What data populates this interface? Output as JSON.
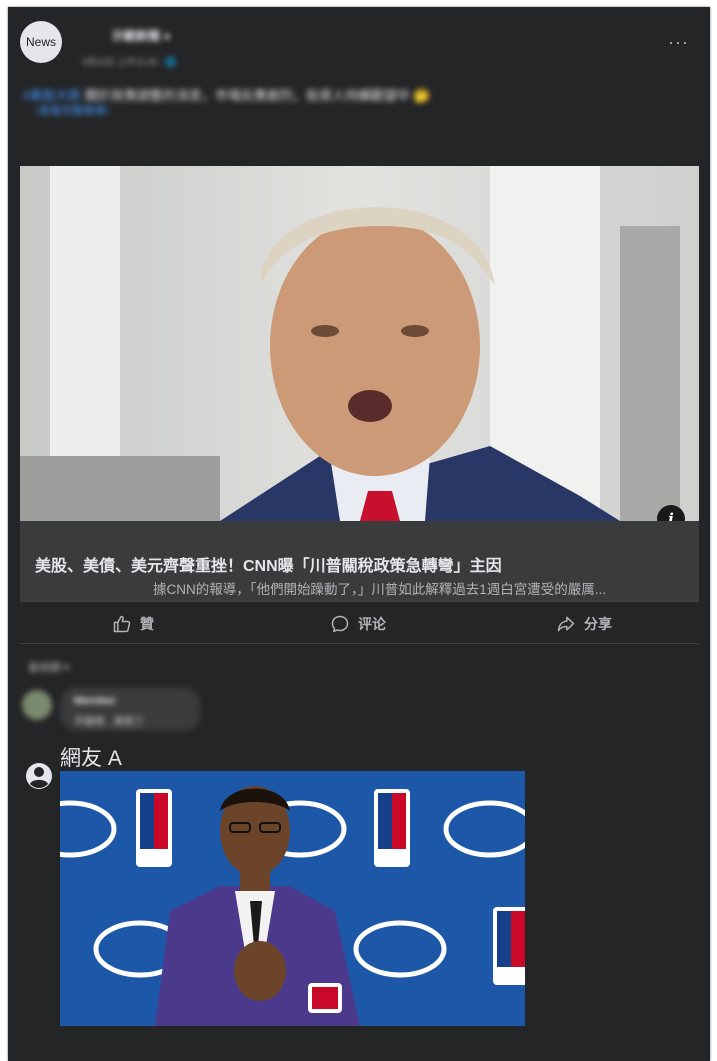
{
  "post": {
    "avatar_text": "News",
    "page_name": "示範新聞 ●",
    "meta": "3月10日 上午11:45 · 🌐",
    "text_highlight": "#美股大跌",
    "text_rest": " 關於政策調整的消息，市場反應劇烈，投資人持續觀望中 🤔",
    "link": "（查看完整報導）",
    "more": "···"
  },
  "article": {
    "title": "美股、美債、美元齊聲重挫！CNN曝「川普關稅政策急轉彎」主因",
    "description": "據CNN的報導，「他們開始躁動了，」川普如此解釋過去1週白宮遭受的嚴厲...",
    "info_icon": "i"
  },
  "actions": {
    "like": "贊",
    "comment": "评论",
    "share": "分享"
  },
  "comments": {
    "sort": "最相關 ▾",
    "blurred_name": "Member",
    "blurred_text": "不是吧…笑死了"
  },
  "reply": {
    "author": "網友 A"
  },
  "colors": {
    "card_bg": "#242526",
    "preview_footer_bg": "#3a3b3c",
    "text_primary": "#e4e6eb",
    "text_secondary": "#b0b3b8",
    "link_blue": "#4599ff"
  },
  "icons": {
    "like": "thumbs-up-icon",
    "comment": "speech-bubble-icon",
    "share": "share-arrow-icon",
    "user": "user-circle-icon",
    "info": "info-icon"
  }
}
